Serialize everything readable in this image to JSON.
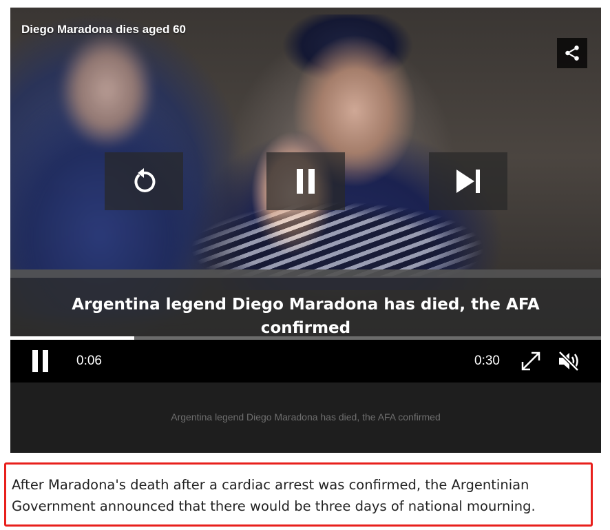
{
  "video": {
    "title": "Diego Maradona dies aged 60",
    "caption": "Argentina legend Diego Maradona has died, the AFA confirmed",
    "progress_fraction": 0.21,
    "icons": {
      "share": "share-icon",
      "replay": "replay-icon",
      "pause": "pause-icon",
      "skip_next": "skip-next-icon",
      "fullscreen": "fullscreen-icon",
      "mute": "muted-speaker-icon"
    }
  },
  "controls": {
    "current_time": "0:06",
    "duration": "0:30"
  },
  "below_player_caption": "Argentina legend Diego Maradona has died, the AFA confirmed",
  "article": {
    "paragraph": "After Maradona's death after a cardiac arrest was confirmed, the Argentinian Government announced that there would be three days of national mourning."
  },
  "colors": {
    "highlight_border": "#e8201c",
    "control_bar": "#000000"
  }
}
